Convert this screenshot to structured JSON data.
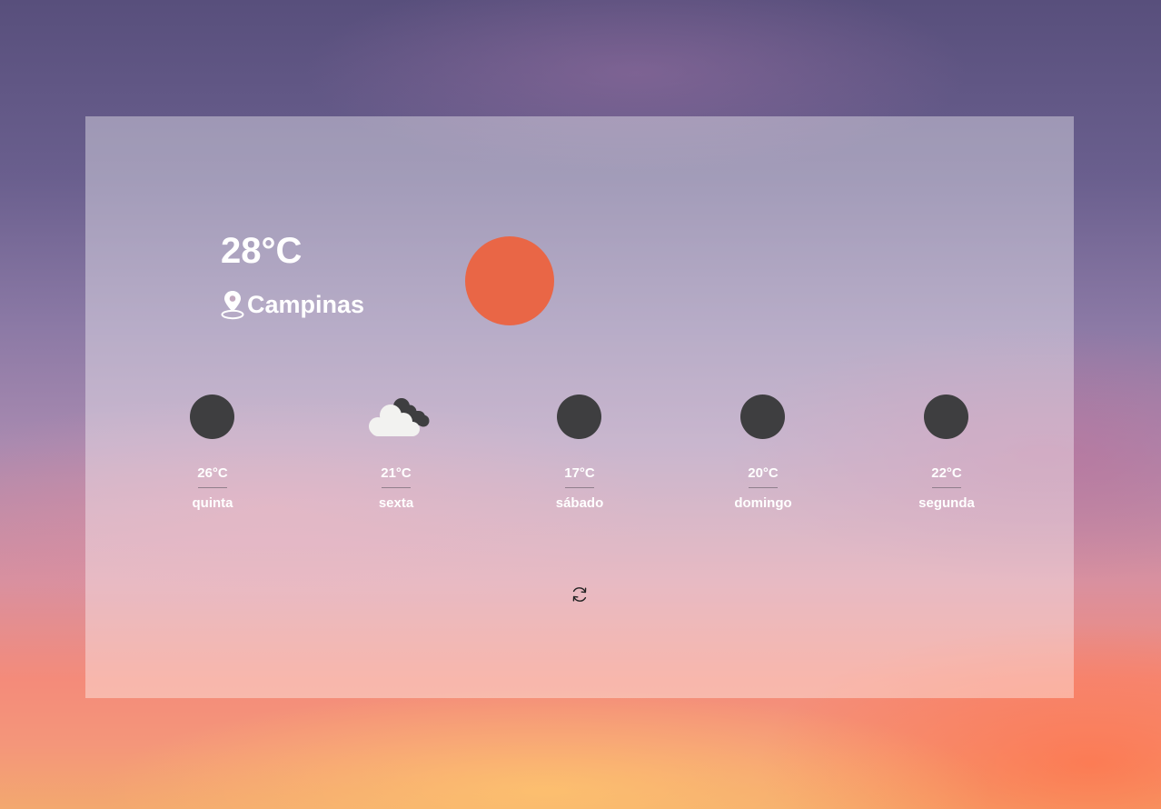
{
  "current": {
    "temperature": "28°C",
    "location": "Campinas",
    "icon": "sun-icon",
    "icon_color": "#e96646"
  },
  "forecast": [
    {
      "temperature": "26°C",
      "day": "quinta",
      "icon": "circle-icon"
    },
    {
      "temperature": "21°C",
      "day": "sexta",
      "icon": "cloud-icon"
    },
    {
      "temperature": "17°C",
      "day": "sábado",
      "icon": "circle-icon"
    },
    {
      "temperature": "20°C",
      "day": "domingo",
      "icon": "circle-icon"
    },
    {
      "temperature": "22°C",
      "day": "segunda",
      "icon": "circle-icon"
    }
  ],
  "controls": {
    "refresh_icon": "refresh-icon"
  },
  "colors": {
    "text": "#ffffff",
    "forecast_icon": "#3e3e40",
    "cloud_light": "#f2f2f0",
    "cloud_dark": "#3e3e40"
  }
}
